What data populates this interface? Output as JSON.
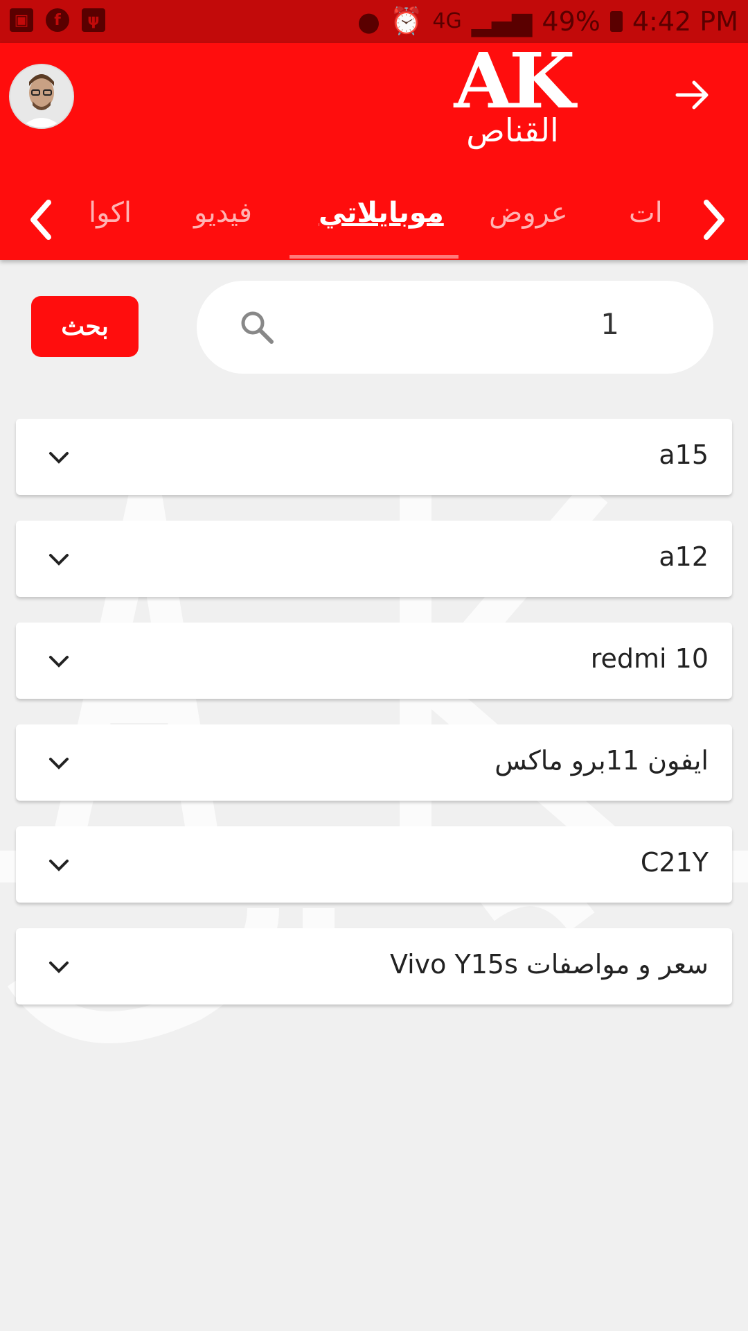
{
  "status_bar": {
    "battery": "49%",
    "network": "4G",
    "time": "4:42 PM"
  },
  "header": {
    "logo_text": "AK",
    "logo_subtitle": "القناص"
  },
  "tabs": [
    {
      "label": "ات",
      "active": false
    },
    {
      "label": "عروض",
      "active": false
    },
    {
      "label": "موبايلاتي",
      "active": true
    },
    {
      "label": "فيديو",
      "active": false
    },
    {
      "label": "اكوا",
      "active": false
    }
  ],
  "search": {
    "value": "1",
    "button_label": "بحث"
  },
  "results": [
    {
      "label": "a15"
    },
    {
      "label": "a12"
    },
    {
      "label": "redmi 10"
    },
    {
      "label": "ايفون 11برو ماكس"
    },
    {
      "label": "C21Y"
    },
    {
      "label": "سعر و مواصفات Vivo Y15s"
    }
  ],
  "colors": {
    "primary": "#ff0d0d",
    "status_bar": "#c20a0a",
    "background": "#f0f0f0"
  }
}
